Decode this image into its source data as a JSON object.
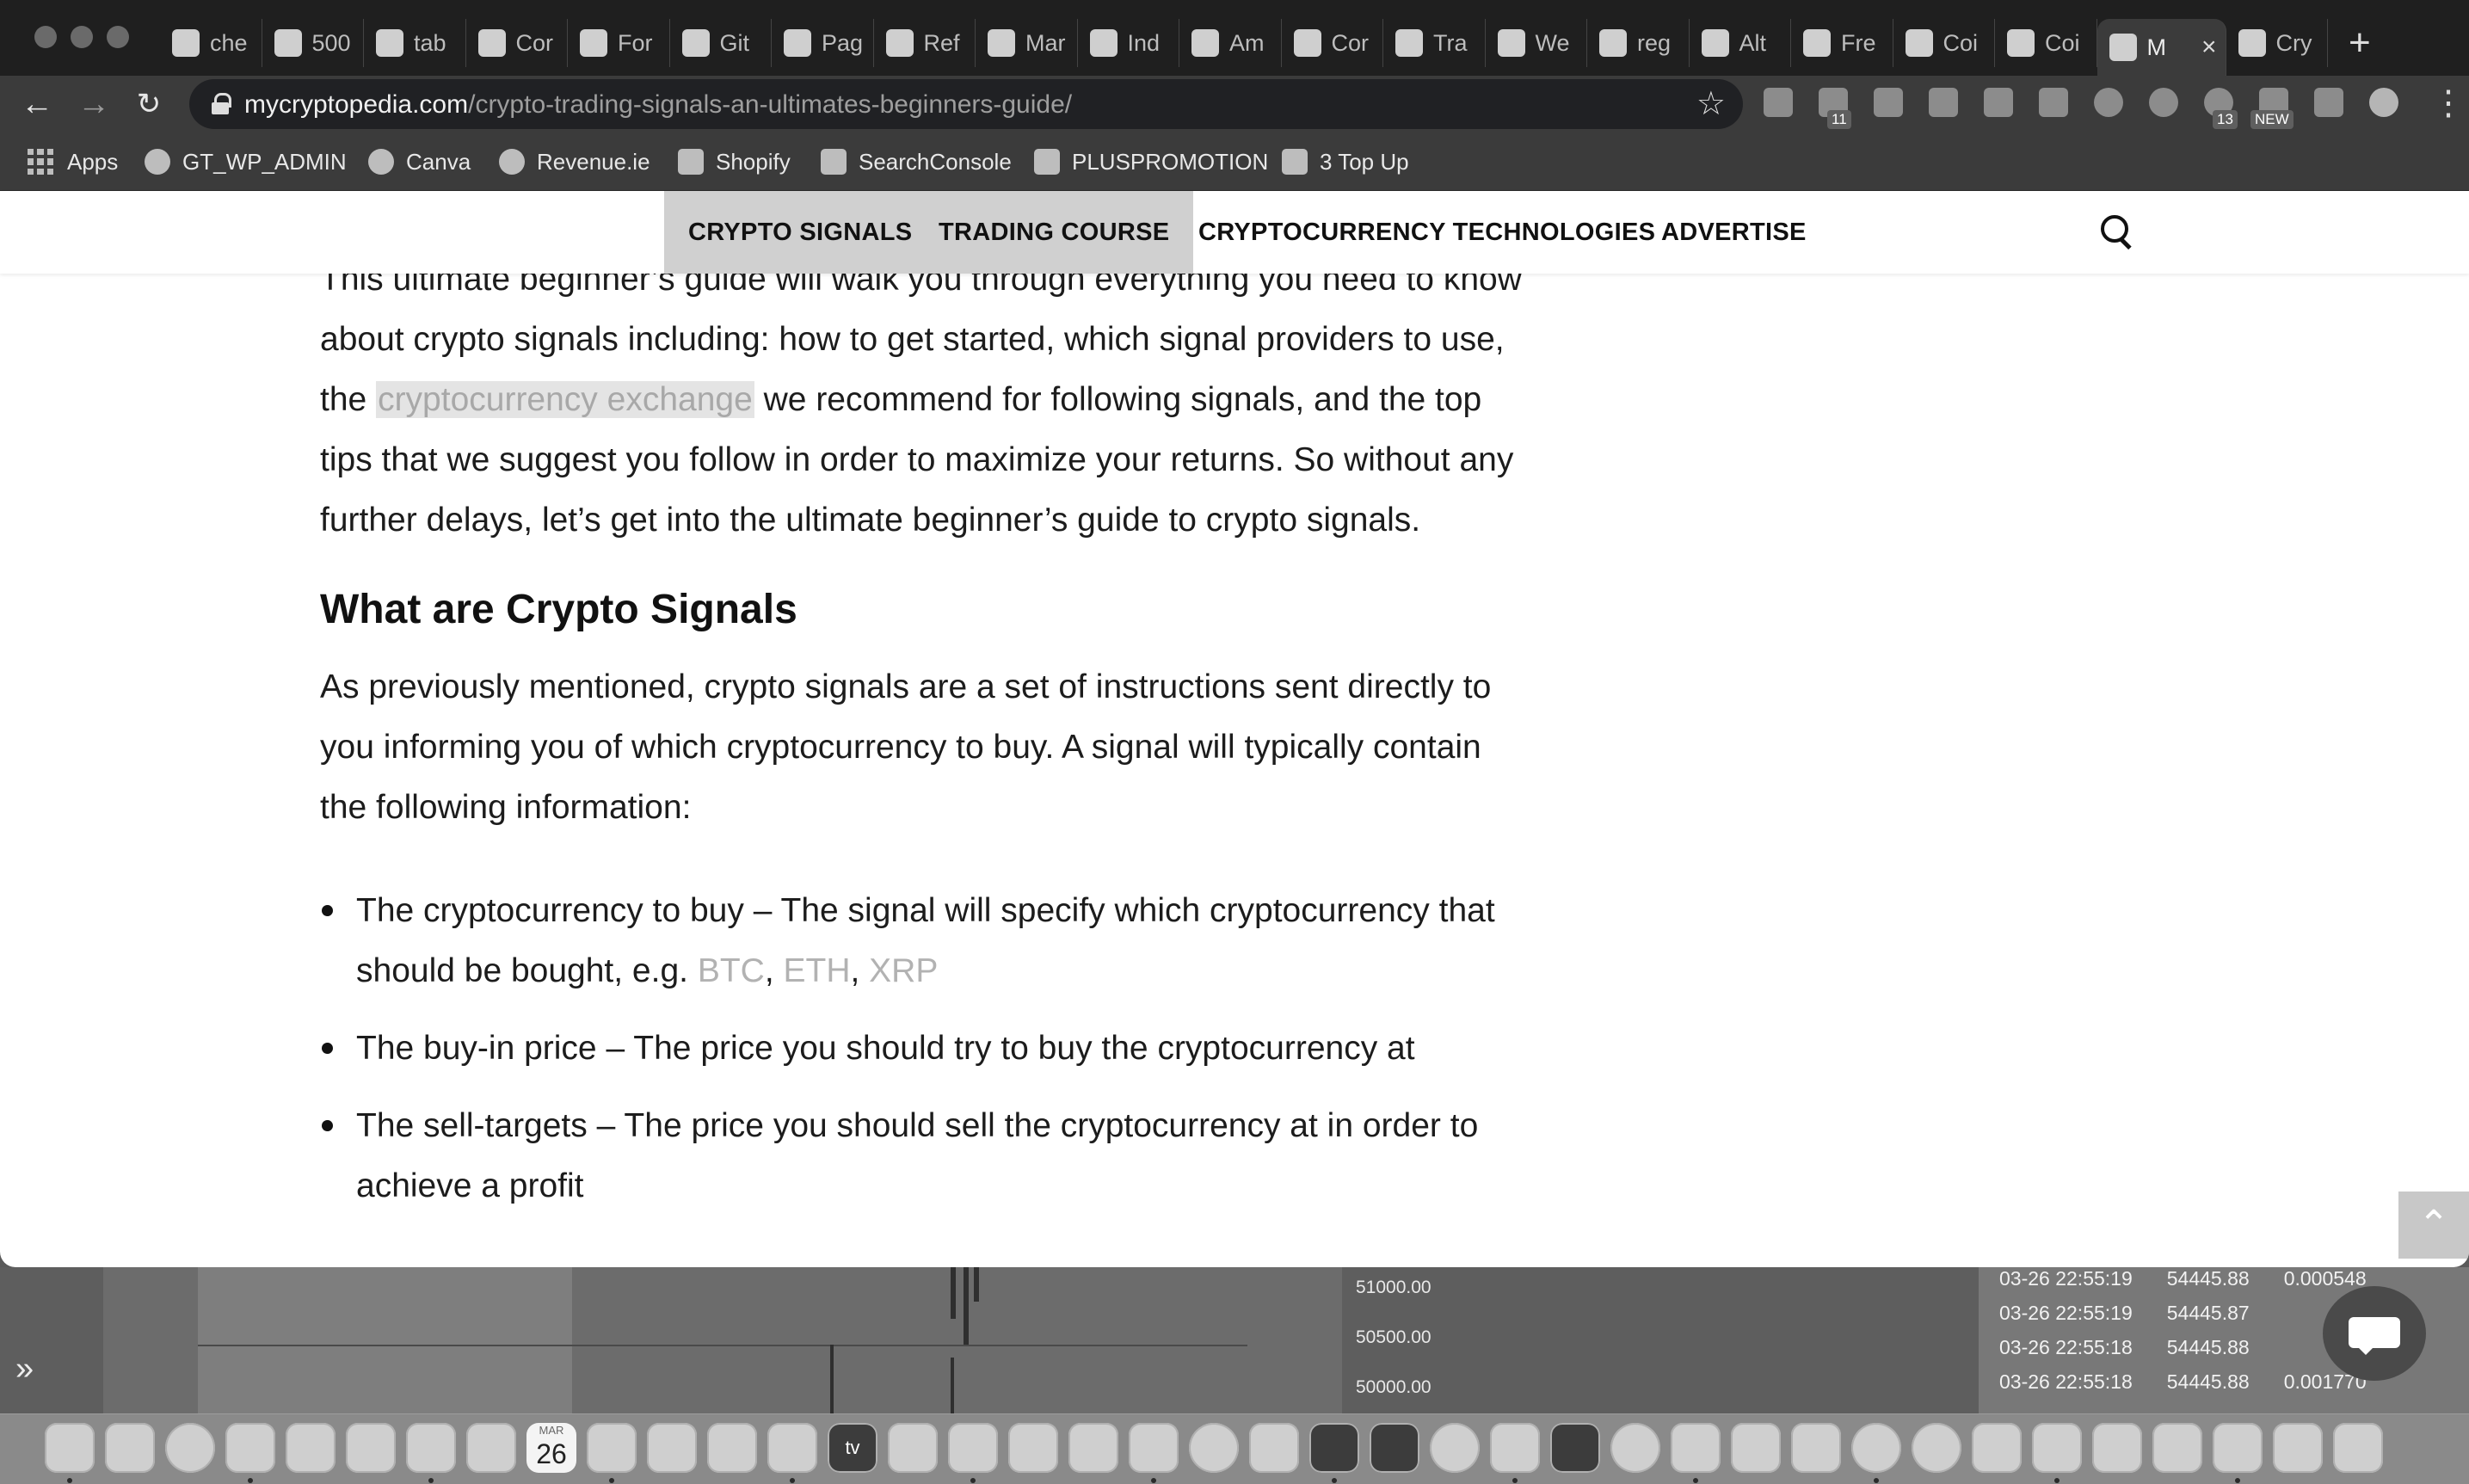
{
  "browser": {
    "tabs": [
      {
        "label": "che",
        "icon": "google-icon"
      },
      {
        "label": "500",
        "icon": "ahrefs-icon"
      },
      {
        "label": "tab",
        "icon": "google-icon"
      },
      {
        "label": "Cor",
        "icon": "stack-icon"
      },
      {
        "label": "For",
        "icon": "form-icon"
      },
      {
        "label": "Git",
        "icon": "github-icon"
      },
      {
        "label": "Pag",
        "icon": "page-icon"
      },
      {
        "label": "Ref",
        "icon": "github-icon"
      },
      {
        "label": "Mar",
        "icon": "cube-icon"
      },
      {
        "label": "Ind",
        "icon": "info-icon"
      },
      {
        "label": "Am",
        "icon": "amazon-icon"
      },
      {
        "label": "Cor",
        "icon": "copy-icon"
      },
      {
        "label": "Tra",
        "icon": "amazon-icon"
      },
      {
        "label": "We",
        "icon": "web-icon"
      },
      {
        "label": "reg",
        "icon": "stack-icon"
      },
      {
        "label": "Alt",
        "icon": "app-icon"
      },
      {
        "label": "Fre",
        "icon": "app-icon"
      },
      {
        "label": "Coi",
        "icon": "coin-icon"
      },
      {
        "label": "Coi",
        "icon": "coin-icon"
      },
      {
        "label": "M",
        "icon": "medium-icon",
        "active": true
      },
      {
        "label": "Cry",
        "icon": "medium-icon"
      }
    ],
    "new_tab": "+",
    "close_tab": "×",
    "url_host": "mycryptopedia.com",
    "url_path": "/crypto-trading-signals-an-ultimates-beginners-guide/",
    "extension_badges": [
      "11",
      "13",
      "NEW"
    ],
    "bookmarks": [
      {
        "label": "Apps"
      },
      {
        "label": "GT_WP_ADMIN"
      },
      {
        "label": "Canva"
      },
      {
        "label": "Revenue.ie"
      },
      {
        "label": "Shopify"
      },
      {
        "label": "SearchConsole"
      },
      {
        "label": "PLUSPROMOTION"
      },
      {
        "label": "3 Top Up"
      }
    ]
  },
  "site": {
    "nav": [
      {
        "label": "CRYPTO SIGNALS"
      },
      {
        "label": "TRADING COURSE"
      },
      {
        "label": "CRYPTOCURRENCY TECHNOLOGIES"
      },
      {
        "label": "ADVERTISE"
      }
    ]
  },
  "article": {
    "intro_start": "This ultimate beginner’s guide will walk you through everything you need to know about crypto signals including: how to get started, which signal providers to use, the ",
    "intro_link": "cryptocurrency exchange",
    "intro_end": " we recommend for following signals, and the top tips that we suggest you follow in order to maximize your returns. So without any further delays, let’s get into the ultimate beginner’s guide to crypto signals.",
    "heading": "What are Crypto Signals",
    "para": "As previously mentioned, crypto signals are a set of instructions sent directly to you informing you of which cryptocurrency to buy. A signal will typically contain the following information:",
    "bullet1_text": "The cryptocurrency to buy – The signal will specify which cryptocurrency that should be bought, e.g. ",
    "bullet1_links": [
      "BTC",
      "ETH",
      "XRP"
    ],
    "bullet2": "The buy-in price – The price you should try to buy the cryptocurrency at",
    "bullet3": "The sell-targets – The price you should sell the cryptocurrency at in order to achieve a profit"
  },
  "background": {
    "price_levels": [
      "51000.00",
      "50500.00",
      "50000.00"
    ],
    "trades": [
      {
        "time": "03-26 22:55:19",
        "price": "54445.88",
        "amount": "0.000548"
      },
      {
        "time": "03-26 22:55:19",
        "price": "54445.87",
        "amount": ""
      },
      {
        "time": "03-26 22:55:18",
        "price": "54445.88",
        "amount": ""
      },
      {
        "time": "03-26 22:55:18",
        "price": "54445.88",
        "amount": "0.001770"
      }
    ]
  },
  "dock": {
    "calendar_month": "MAR",
    "calendar_day": "26",
    "tv_label": "tv"
  }
}
